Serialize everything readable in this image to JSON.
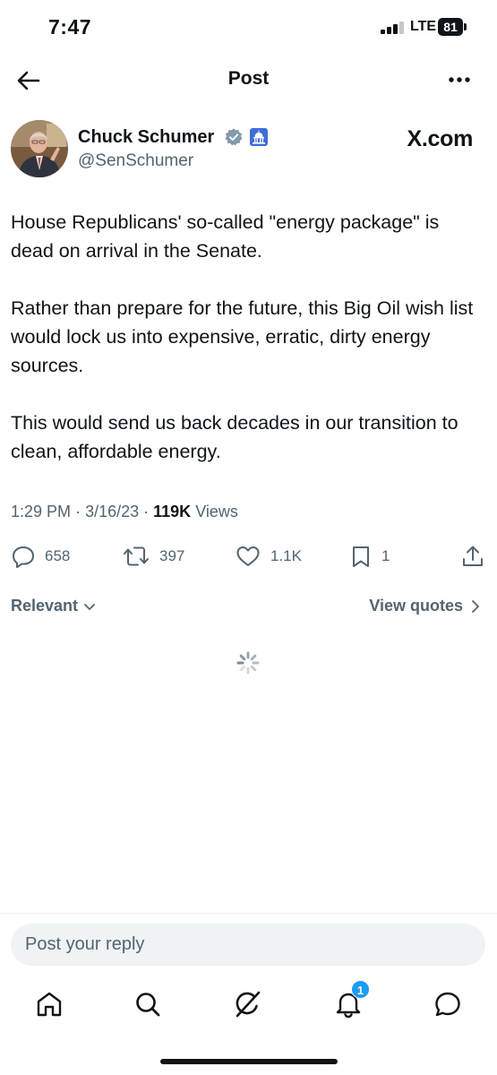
{
  "status_bar": {
    "time": "7:47",
    "network": "LTE",
    "battery": "81"
  },
  "nav": {
    "title": "Post"
  },
  "author": {
    "name": "Chuck Schumer",
    "handle": "@SenSchumer",
    "source": "X.com"
  },
  "tweet": {
    "paragraphs": [
      "House Republicans' so-called \"energy package\" is dead on arrival in the Senate.",
      "Rather than prepare for the future, this Big Oil wish list would lock us into expensive, erratic, dirty energy sources.",
      "This would send us back decades in our transition to clean, affordable energy."
    ],
    "time": "1:29 PM",
    "date": "3/16/23",
    "views_count": "119K",
    "views_label": "Views"
  },
  "actions": {
    "replies": "658",
    "reposts": "397",
    "likes": "1.1K",
    "bookmarks": "1"
  },
  "replies_bar": {
    "sort_label": "Relevant",
    "quotes_label": "View quotes"
  },
  "reply_box": {
    "placeholder": "Post your reply"
  },
  "tab_bar": {
    "notification_count": "1"
  },
  "colors": {
    "text": "#0f1419",
    "secondary": "#536471",
    "accent": "#1d9bf0",
    "reply_bg": "#eff3f4"
  },
  "icons": [
    "back-arrow-icon",
    "more-icon",
    "verified-badge-icon",
    "government-label-icon",
    "reply-icon",
    "repost-icon",
    "like-icon",
    "bookmark-icon",
    "share-icon",
    "chevron-down-icon",
    "chevron-right-icon",
    "loading-spinner-icon",
    "home-icon",
    "search-icon",
    "grok-icon",
    "notifications-icon",
    "messages-icon"
  ]
}
